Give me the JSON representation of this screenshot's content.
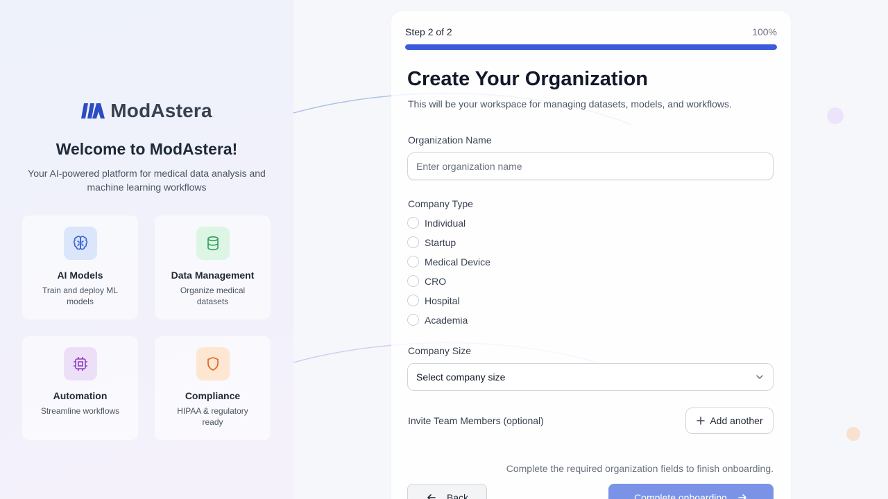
{
  "brand": {
    "name": "ModAstera",
    "welcome": "Welcome to ModAstera!",
    "tagline": "Your AI-powered platform for medical data analysis and machine learning workflows"
  },
  "features": [
    {
      "title": "AI Models",
      "desc": "Train and deploy ML models",
      "icon": "brain-icon",
      "color": "#3b63d6",
      "bg": "#dbe6fb"
    },
    {
      "title": "Data Management",
      "desc": "Organize medical datasets",
      "icon": "database-icon",
      "color": "#2f9e57",
      "bg": "#dcf5e4"
    },
    {
      "title": "Automation",
      "desc": "Streamline workflows",
      "icon": "chip-icon",
      "color": "#8b3fc4",
      "bg": "#eedff8"
    },
    {
      "title": "Compliance",
      "desc": "HIPAA & regulatory ready",
      "icon": "shield-icon",
      "color": "#e06a1f",
      "bg": "#fde6d2"
    }
  ],
  "form": {
    "step_label": "Step 2 of 2",
    "progress_label": "100%",
    "progress_value": 1.0,
    "title": "Create Your Organization",
    "subtitle": "This will be your workspace for managing datasets, models, and workflows.",
    "org_name_label": "Organization Name",
    "org_name_placeholder": "Enter organization name",
    "org_name_value": "",
    "company_type_label": "Company Type",
    "company_types": [
      "Individual",
      "Startup",
      "Medical Device",
      "CRO",
      "Hospital",
      "Academia"
    ],
    "company_size_label": "Company Size",
    "company_size_value": "Select company size",
    "invite_label": "Invite Team Members (optional)",
    "add_another_label": "Add another",
    "hint": "Complete the required organization fields to finish onboarding.",
    "back_label": "Back",
    "complete_label": "Complete onboarding"
  },
  "colors": {
    "accent": "#3b5bdb",
    "accent_disabled": "#7b93e6"
  }
}
